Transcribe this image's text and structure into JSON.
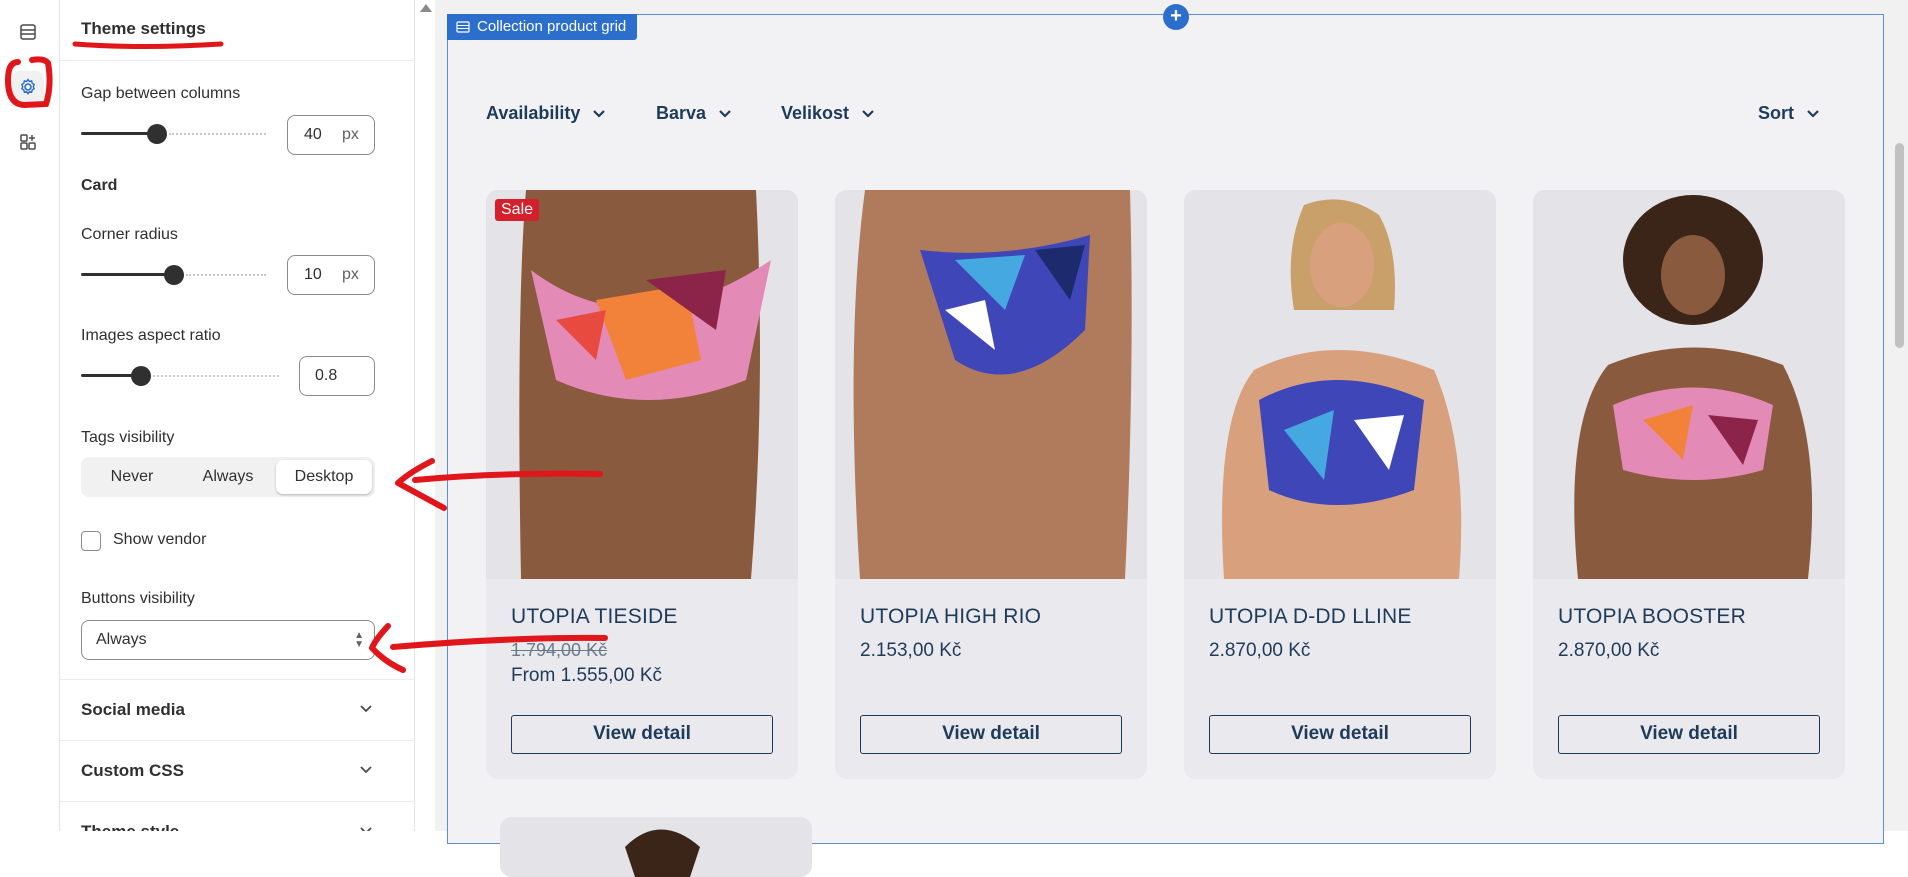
{
  "sidebar": {
    "icons": [
      "sections-icon",
      "settings-gear-icon",
      "apps-icon"
    ]
  },
  "panel": {
    "title": "Theme settings",
    "gap_label": "Gap between columns",
    "gap_value": "40",
    "gap_unit": "px",
    "gap_level": 0.4,
    "card_heading": "Card",
    "radius_label": "Corner radius",
    "radius_value": "10",
    "radius_unit": "px",
    "radius_level": 0.5,
    "aspect_label": "Images aspect ratio",
    "aspect_value": "0.8",
    "aspect_level": 0.28,
    "tags_label": "Tags visibility",
    "tags_options": [
      "Never",
      "Always",
      "Desktop"
    ],
    "tags_selected": "Desktop",
    "vendor_label": "Show vendor",
    "vendor_checked": false,
    "buttons_label": "Buttons visibility",
    "buttons_value": "Always",
    "sections": [
      "Social media",
      "Custom CSS",
      "Theme style"
    ]
  },
  "preview": {
    "block_tag": "Collection product grid",
    "filters": [
      "Availability",
      "Barva",
      "Velikost"
    ],
    "sort_label": "Sort",
    "products": [
      {
        "name": "UTOPIA TIESIDE",
        "old_price": "1.794,00 Kč",
        "price": "From 1.555,00 Kč",
        "badge": "Sale",
        "button": "View detail"
      },
      {
        "name": "UTOPIA HIGH RIO",
        "price": "2.153,00 Kč",
        "button": "View detail"
      },
      {
        "name": "UTOPIA D-DD LLINE",
        "price": "2.870,00 Kč",
        "button": "View detail"
      },
      {
        "name": "UTOPIA BOOSTER",
        "price": "2.870,00 Kč",
        "button": "View detail"
      }
    ]
  },
  "colors": {
    "accent": "#2c6ecb",
    "annotation_red": "#e0161a",
    "product_text": "#1f3b5a",
    "sale_badge": "#d41f2c"
  }
}
